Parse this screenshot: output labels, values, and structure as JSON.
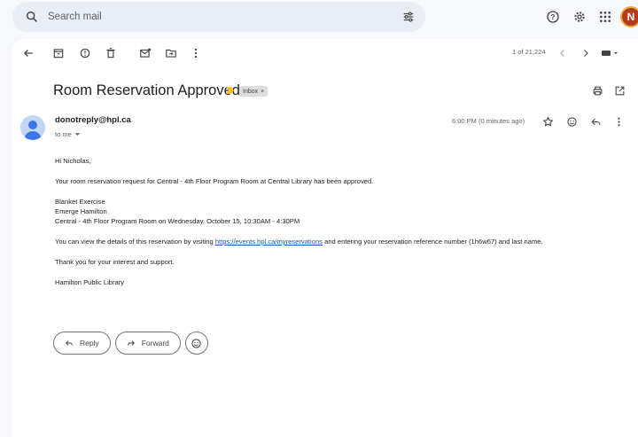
{
  "search": {
    "placeholder": "Search mail"
  },
  "header": {
    "avatar_initial": "N"
  },
  "toolbar": {
    "pager": "1 of 21,224"
  },
  "message": {
    "subject": "Room Reservation Approved",
    "label": "Inbox",
    "label_remove": "×",
    "sender": "donotreply@hpl.ca",
    "to": "to me",
    "time": "6:00 PM (0 minutes ago)",
    "body": {
      "greeting": "Hi Nicholas,",
      "line1": "Your room reservation request for Central - 4th Floor Program Room at Central Library has been approved.",
      "event_line1": "Blanket Exercise",
      "event_line2": "Emerge Hamilton",
      "event_line3": "Central - 4th Floor Program Room on Wednesday, October 15, 10:30AM - 4:30PM",
      "details_prefix": "You can view the details of this reservation by visiting",
      "details_link": "https://events.hpl.ca/myreservations",
      "details_suffix": "and entering your reservation reference number (1h6w67) and last name.",
      "thanks": "Thank you for your interest and support.",
      "signature": "Hamilton Public Library"
    }
  },
  "actions": {
    "reply": "Reply",
    "forward": "Forward"
  },
  "colors": {
    "accent_link": "#1a56c9",
    "important_marker": "#f6c026",
    "avatar_bg": "#b33a1a"
  }
}
